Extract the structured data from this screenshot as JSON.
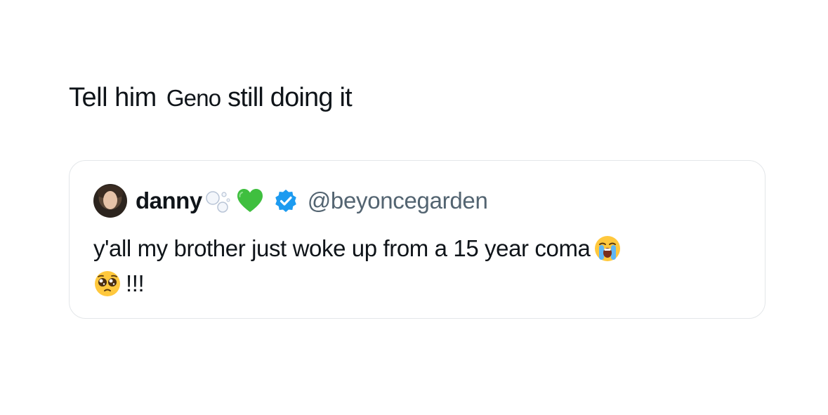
{
  "tweet": {
    "text_part1": "Tell him",
    "text_part2_a": "Geno",
    "text_part2_b": " still doing it"
  },
  "quote": {
    "display_name": "danny",
    "handle": "@beyoncegarden",
    "line1": "y'all my brother just woke up from a 15 year coma",
    "line2": "!!!",
    "icons": {
      "avatar": "avatar",
      "bubbles": "bubbles-icon",
      "heart": "green-heart-icon",
      "verified": "verified-badge-icon",
      "crying": "loudly-crying-face-icon",
      "pleading": "pleading-face-icon"
    },
    "colors": {
      "verified": "#1d9bf0",
      "heart": "#3fbf3f",
      "handle": "#536471",
      "border": "#e3e6e9"
    }
  }
}
